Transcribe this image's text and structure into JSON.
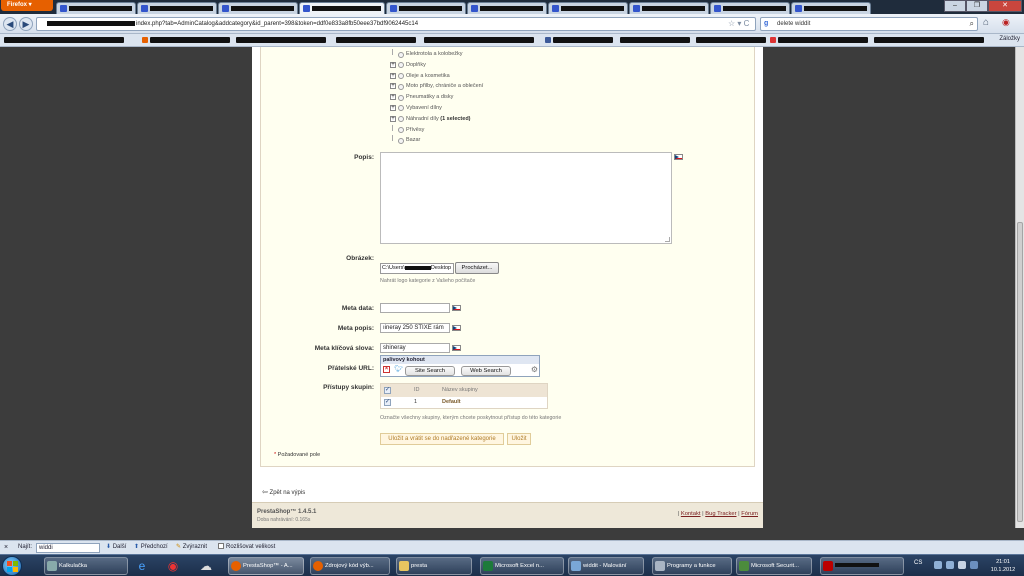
{
  "browser": {
    "menu_label": "Firefox",
    "url": "index.php?tab=AdminCatalog&addcategory&id_parent=398&token=ddf0e833a8fb50eee37bdf9062445c14",
    "search_value": "delete widdit",
    "search_engine_icon": "google-icon",
    "bookmarks_label": "Záložky"
  },
  "tree": {
    "items": [
      {
        "label": "Elektrotola a kolobežky",
        "expandable": false
      },
      {
        "label": "Doplňky",
        "expandable": true
      },
      {
        "label": "Oleje a kosmetika",
        "expandable": true
      },
      {
        "label": "Moto přilby, chrániče a oblečení",
        "expandable": true
      },
      {
        "label": "Pneumatiky a disky",
        "expandable": true
      },
      {
        "label": "Vybavení dílny",
        "expandable": true
      },
      {
        "label": "Náhradní díly",
        "expandable": true,
        "suffix": "(1 selected)"
      },
      {
        "label": "Přívěsy",
        "expandable": false
      },
      {
        "label": "Bazar",
        "expandable": false
      }
    ]
  },
  "form": {
    "popis_label": "Popis:",
    "obrazek_label": "Obrázek:",
    "file_path_start": "C:\\Users\\",
    "file_path_end": "Desktop",
    "browse_button": "Procházet...",
    "file_hint": "Nahrát logo kategorie z Vašeho počítače",
    "meta_data_label": "Meta data:",
    "meta_data_value": "",
    "meta_popis_label": "Meta popis:",
    "meta_popis_value": "ıineray 250 STIXE rám",
    "meta_keywords_label": "Meta klíčová slova:",
    "meta_keywords_value": "shineray",
    "friendly_url_label": "Přátelské URL:",
    "groups_label": "Přístupy skupin:",
    "groups_hint": "Označte všechny skupiny, kterým chcete poskytnout přístup do této kategorie",
    "save_back_button": "Uložit a vrátit se do nadřazené kategorie",
    "save_button": "Uložit",
    "required_note": "Požadované pole"
  },
  "autocomplete": {
    "suggestion": "palivový kohout",
    "site_search": "Site Search",
    "web_search": "Web Search"
  },
  "groups_table": {
    "headers": {
      "id": "ID",
      "name": "Název skupiny"
    },
    "rows": [
      {
        "id": "1",
        "name": "Default",
        "checked": true
      }
    ]
  },
  "back_link": "Zpět na výpis",
  "footer": {
    "brand": "PrestaShop™ 1.4.5.1",
    "load_time": "Doba nahrávání: 0.165s",
    "link_contact": "Kontakt",
    "link_bug": "Bug Tracker",
    "link_forum": "Fórum"
  },
  "findbar": {
    "find_label": "Najít:",
    "find_value": "widdi",
    "next": "Další",
    "previous": "Předchozí",
    "highlight": "Zvýraznit",
    "match_case": "Rozlišovat velikost"
  },
  "taskbar": {
    "items": [
      {
        "label": "Kalkulačka"
      },
      {
        "label": "PrestaShop™ - A..."
      },
      {
        "label": "Zdrojový kód výb..."
      },
      {
        "label": "presta"
      },
      {
        "label": "Microsoft Excel n..."
      },
      {
        "label": "widdit - Malování"
      },
      {
        "label": "Programy a funkce"
      },
      {
        "label": "Microsoft Securit..."
      }
    ],
    "lang": "CS",
    "time": "21:01",
    "date": "10.1.2012"
  },
  "colors": {
    "firefox_orange": "#e66000",
    "form_background": "#fffff0",
    "page_background": "#3c3c3c",
    "action_text": "#b07d2a"
  }
}
